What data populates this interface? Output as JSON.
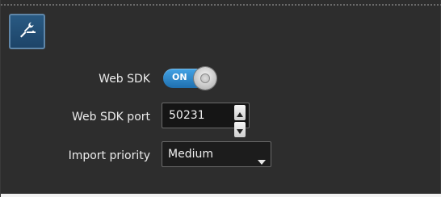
{
  "toolbar": {
    "tool_icon": "wrench-icon"
  },
  "settings": {
    "web_sdk": {
      "label": "Web SDK",
      "toggle_text": "ON",
      "enabled": true
    },
    "web_sdk_port": {
      "label": "Web SDK port",
      "value": "50231",
      "up_icon": "chevron-up-icon",
      "down_icon": "chevron-down-icon"
    },
    "import_priority": {
      "label": "Import priority",
      "selected": "Medium",
      "dropdown_icon": "chevron-down-icon"
    }
  },
  "colors": {
    "panel_bg": "#2d2d2d",
    "accent": "#2f86c9",
    "tool_button": "#295a83"
  }
}
